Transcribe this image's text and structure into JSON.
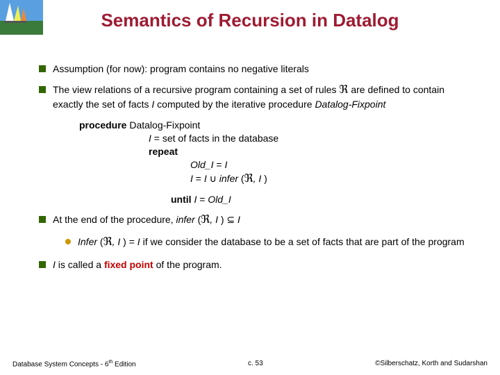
{
  "title": "Semantics of Recursion in Datalog",
  "bullets": {
    "b1": "Assumption (for now): program contains no negative literals",
    "b2_pre": "The view relations of a recursive program containing a set of rules ",
    "b2_r": "ℜ",
    "b2_mid": " are defined to contain exactly the set of facts ",
    "b2_i": "I",
    "b2_post": " computed by the iterative procedure ",
    "b2_proc": "Datalog-Fixpoint",
    "b3_pre": "At the end of the procedure, ",
    "b3_infer": "infer ",
    "b3_paren_open": "(",
    "b3_r": "ℜ",
    "b3_comma": ", ",
    "b3_i": "I ",
    "b3_paren_close": ")  ⊆  ",
    "b3_i2": "I",
    "b4_i": "I",
    "b4_mid": " is called a ",
    "b4_fixed": "fixed point",
    "b4_post": " of the program."
  },
  "sub": {
    "s1_infer": "Infer ",
    "s1_open": "(",
    "s1_r": "ℜ",
    "s1_comma": ", ",
    "s1_i": "I ",
    "s1_close": ")  =  ",
    "s1_i2": "I",
    "s1_post": "  if we consider the database to be a set of facts that are part of the program"
  },
  "proc": {
    "kw_proc": "procedure",
    "name": "  Datalog-Fixpoint",
    "l2_i": "I",
    "l2_rest": " = set of facts in the database",
    "kw_repeat": "repeat",
    "l4_pre": "Old_",
    "l4_i": "I",
    "l4_eq": " = ",
    "l4_i2": "I",
    "l5_i": "I",
    "l5_eq": " = ",
    "l5_i2": "I",
    "l5_cup": "  ∪  ",
    "l5_infer": "infer ",
    "l5_open": "(",
    "l5_r": "ℜ",
    "l5_comma": ", ",
    "l5_i3": "I ",
    "l5_close": ")",
    "kw_until": "until ",
    "u_i": "I",
    "u_eq": " = ",
    "u_pre": "Old_",
    "u_i2": "I"
  },
  "footer": {
    "left_a": "Database System Concepts - 6",
    "left_sup": "th",
    "left_b": " Edition",
    "center": "c. 53",
    "right": "©Silberschatz, Korth and Sudarshan"
  }
}
